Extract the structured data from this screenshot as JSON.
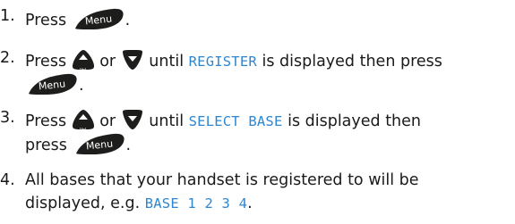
{
  "keys": {
    "menu": "Menu",
    "vol": "Vol"
  },
  "colors": {
    "key_fill": "#1d1d1b",
    "lcd_text": "#2f86d0"
  },
  "steps": [
    {
      "number": "1.",
      "press": "Press",
      "end": "."
    },
    {
      "number": "2.",
      "press": "Press",
      "or": "or",
      "until": "until",
      "display": "REGISTER",
      "after": "is displayed then press",
      "end": "."
    },
    {
      "number": "3.",
      "press": "Press",
      "or": "or",
      "until": "until",
      "display": "SELECT BASE",
      "after": "is displayed then",
      "press2": "press",
      "end": "."
    },
    {
      "number": "4.",
      "text_line1": "All bases that your handset is registered to will be",
      "text_line2": "displayed, e.g.",
      "display": "BASE 1 2 3 4",
      "end": "."
    }
  ]
}
